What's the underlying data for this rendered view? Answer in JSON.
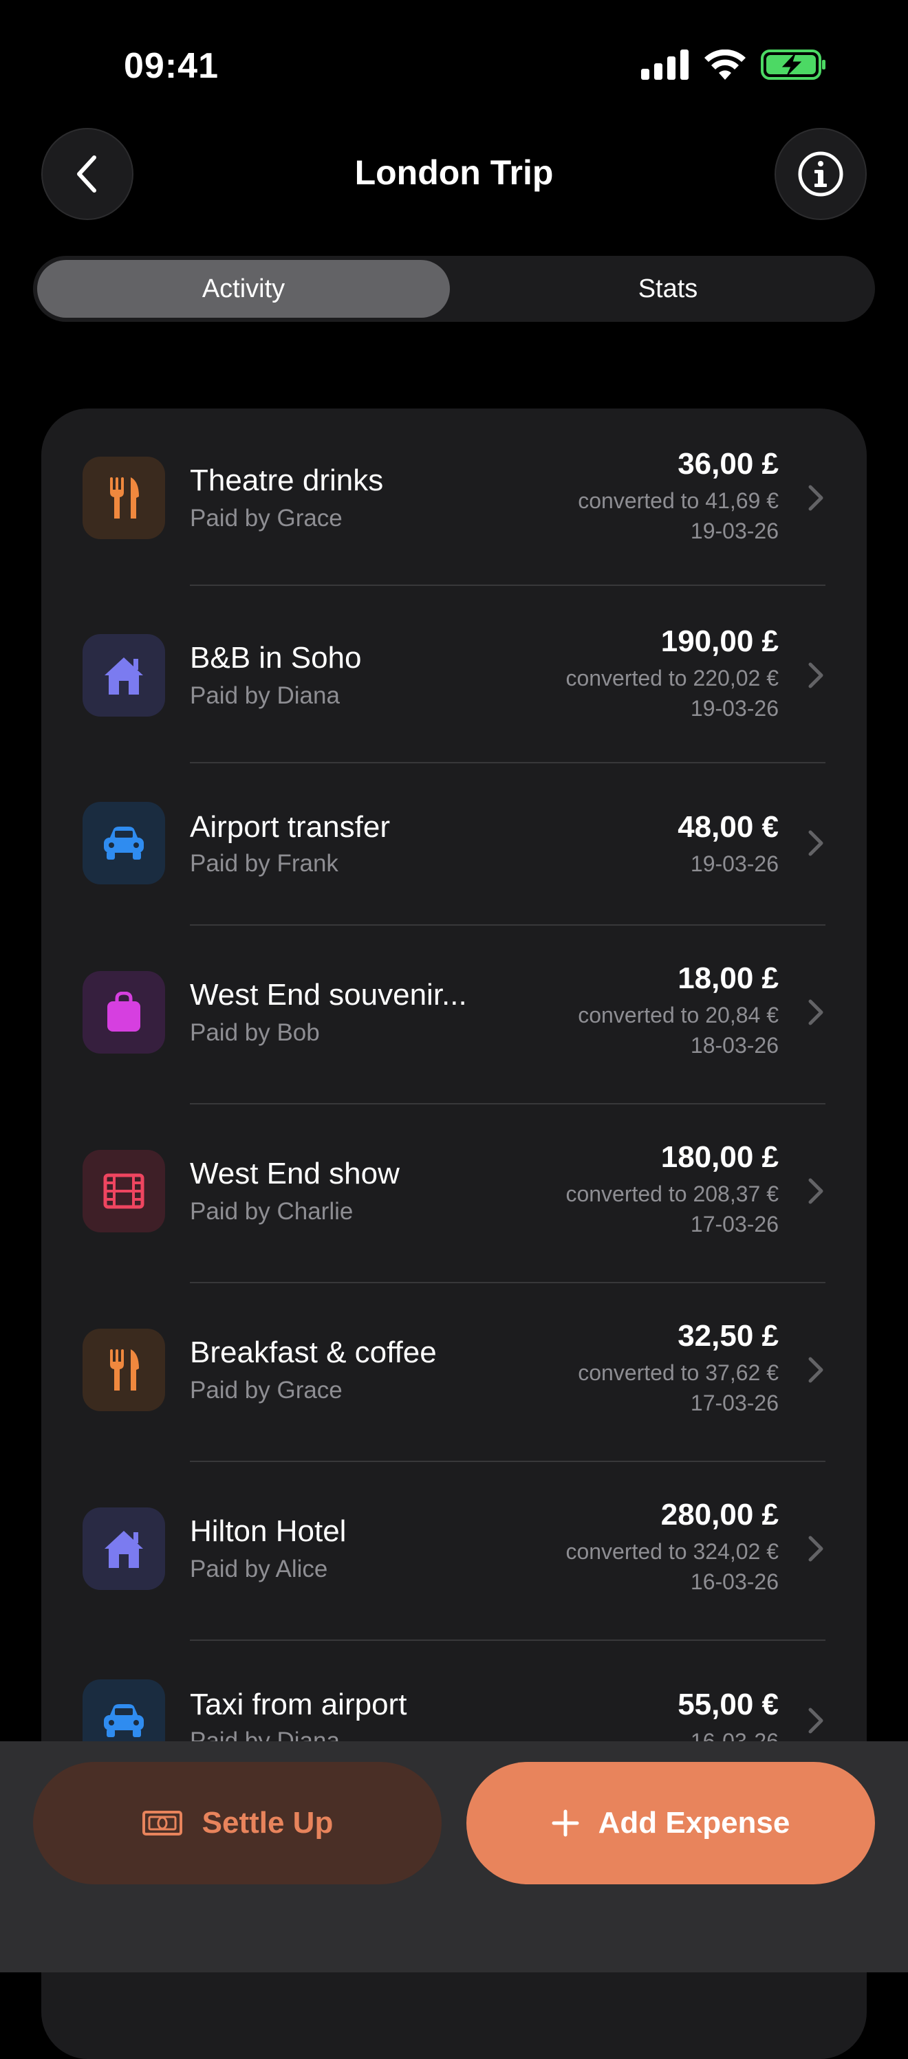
{
  "status_bar": {
    "time": "09:41"
  },
  "nav": {
    "title": "London Trip",
    "back_icon": "chevron-left-icon",
    "info_icon": "info-icon"
  },
  "segments": [
    {
      "label": "Activity",
      "active": true
    },
    {
      "label": "Stats",
      "active": false
    }
  ],
  "expenses": [
    {
      "title": "Theatre drinks",
      "paid_by": "Paid by Grace",
      "amount": "36,00 £",
      "converted": "converted to 41,69 €",
      "date": "19-03-26",
      "icon": "fork-knife-icon",
      "icon_color": "#f0883e",
      "icon_bg": "#3a2a1e"
    },
    {
      "title": "B&B in Soho",
      "paid_by": "Paid by Diana",
      "amount": "190,00 £",
      "converted": "converted to 220,02 €",
      "date": "19-03-26",
      "icon": "house-icon",
      "icon_color": "#7b7bf0",
      "icon_bg": "#292a44"
    },
    {
      "title": "Airport transfer",
      "paid_by": "Paid by Frank",
      "amount": "48,00 €",
      "converted": "",
      "date": "19-03-26",
      "icon": "car-icon",
      "icon_color": "#2f8cf0",
      "icon_bg": "#1a2c40"
    },
    {
      "title": "West End souvenir...",
      "paid_by": "Paid by Bob",
      "amount": "18,00 £",
      "converted": "converted to 20,84 €",
      "date": "18-03-26",
      "icon": "bag-icon",
      "icon_color": "#d63fe0",
      "icon_bg": "#361f3e"
    },
    {
      "title": "West End show",
      "paid_by": "Paid by Charlie",
      "amount": "180,00 £",
      "converted": "converted to 208,37 €",
      "date": "17-03-26",
      "icon": "film-icon",
      "icon_color": "#ef4560",
      "icon_bg": "#3e1f27"
    },
    {
      "title": "Breakfast & coffee",
      "paid_by": "Paid by Grace",
      "amount": "32,50 £",
      "converted": "converted to 37,62 €",
      "date": "17-03-26",
      "icon": "fork-knife-icon",
      "icon_color": "#f0883e",
      "icon_bg": "#3a2a1e"
    },
    {
      "title": "Hilton Hotel",
      "paid_by": "Paid by Alice",
      "amount": "280,00 £",
      "converted": "converted to 324,02 €",
      "date": "16-03-26",
      "icon": "house-icon",
      "icon_color": "#7b7bf0",
      "icon_bg": "#292a44"
    },
    {
      "title": "Taxi from airport",
      "paid_by": "Paid by Diana",
      "amount": "55,00 €",
      "converted": "",
      "date": "16-03-26",
      "icon": "car-icon",
      "icon_color": "#2f8cf0",
      "icon_bg": "#1a2c40"
    }
  ],
  "actions": {
    "settle_label": "Settle Up",
    "settle_icon": "banknote-icon",
    "add_label": "Add Expense",
    "add_icon": "plus-icon",
    "accent_color": "#e8845c"
  }
}
